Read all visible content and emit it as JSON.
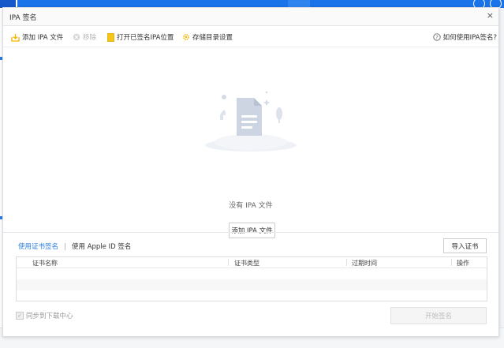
{
  "dialog": {
    "title": "IPA 签名",
    "close_glyph": "×"
  },
  "toolbar": {
    "add_ipa": "添加 IPA 文件",
    "remove": "移除",
    "open_location": "打开已签名IPA位置",
    "storage_settings": "存储目录设置",
    "help": "如何使用IPA签名?"
  },
  "empty_state": {
    "message": "没有 IPA 文件",
    "add_button": "添加 IPA 文件"
  },
  "signing": {
    "tabs": [
      "使用证书签名",
      "使用 Apple ID 签名"
    ],
    "active_tab": 0,
    "import_cert_button": "导入证书"
  },
  "cert_table": {
    "columns": [
      "证书名称",
      "证书类型",
      "过期时间",
      "操作"
    ],
    "rows": []
  },
  "footer": {
    "sync_label": "同步到下载中心",
    "sync_checked": true,
    "start_button": "开始签名"
  },
  "colors": {
    "accent": "#2a7de1",
    "toolbar_icon": "#f5b400"
  }
}
